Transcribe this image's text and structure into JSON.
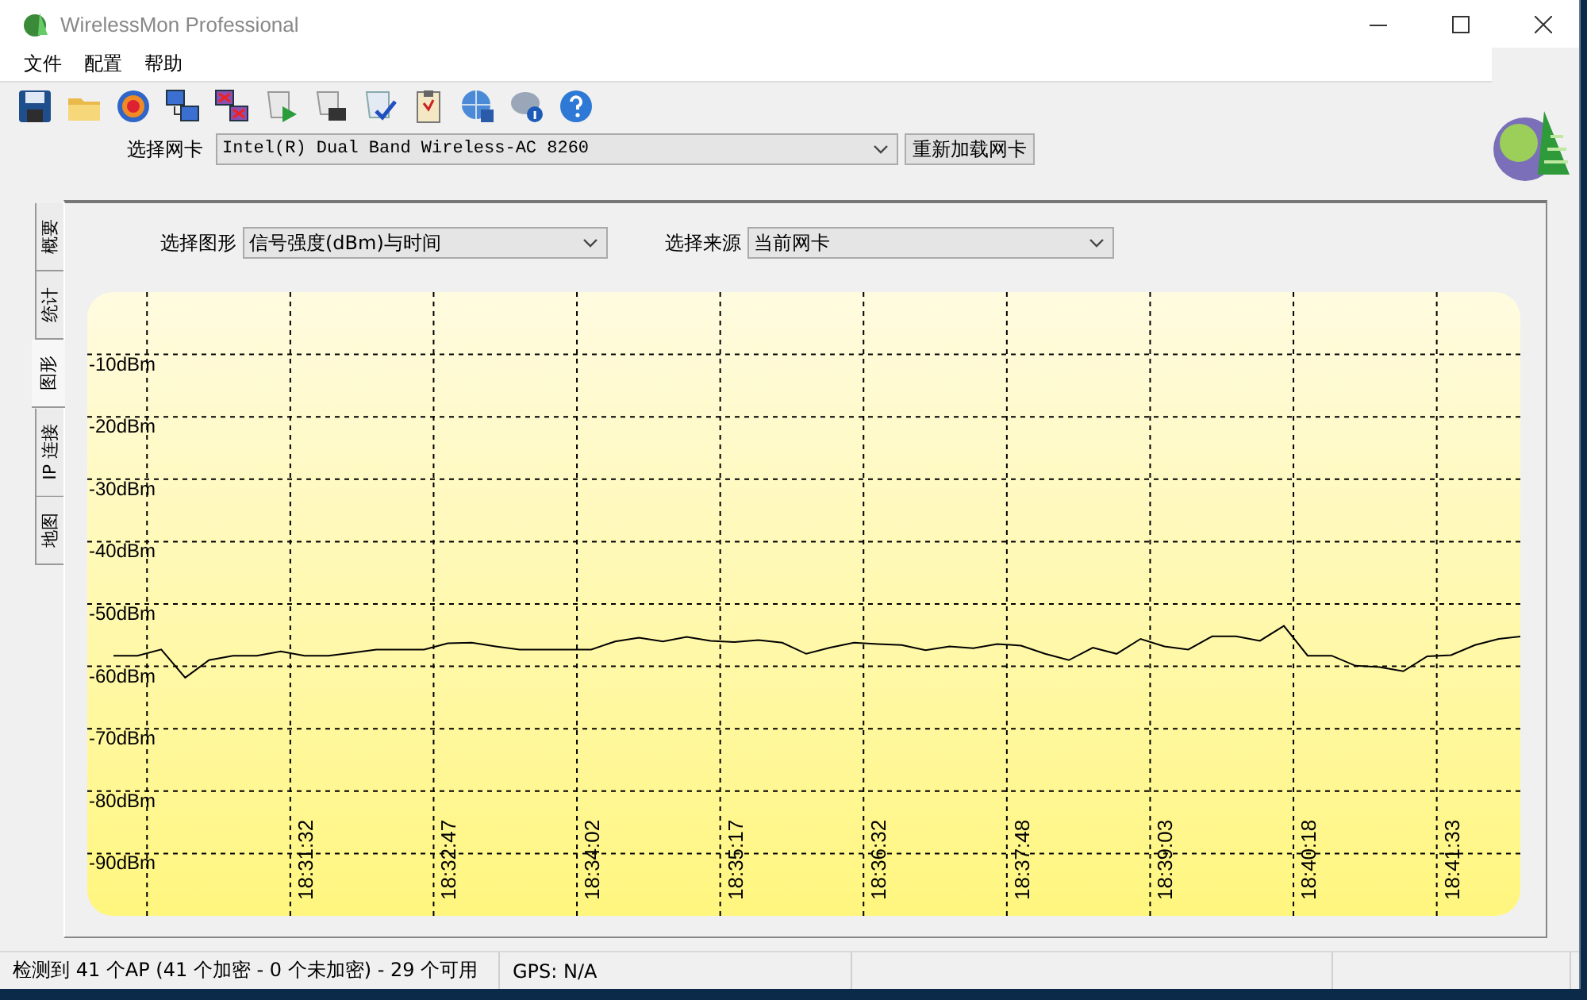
{
  "window": {
    "title": "WirelessMon Professional"
  },
  "menu": [
    "文件",
    "配置",
    "帮助"
  ],
  "adapter": {
    "label": "选择网卡",
    "value": "Intel(R) Dual Band Wireless-AC 8260",
    "reload_button": "重新加载网卡"
  },
  "tabs": [
    {
      "label": "概要",
      "selected": false
    },
    {
      "label": "统计",
      "selected": false
    },
    {
      "label": "图形",
      "selected": true
    },
    {
      "label": "IP 连接",
      "selected": false
    },
    {
      "label": "地图",
      "selected": false
    }
  ],
  "graph_select": {
    "label": "选择图形",
    "value": "信号强度(dBm)与时间"
  },
  "source_select": {
    "label": "选择来源",
    "value": "当前网卡"
  },
  "chart_data": {
    "type": "line",
    "ylim": [
      -100,
      0
    ],
    "categories": [
      null,
      null,
      null,
      null,
      null,
      null,
      null,
      null,
      "18:31:32",
      null,
      null,
      null,
      null,
      null,
      "18:32:47",
      null,
      null,
      null,
      null,
      null,
      "18:34:02",
      null,
      null,
      null,
      null,
      null,
      "18:35:17",
      null,
      null,
      null,
      null,
      null,
      "18:36:32",
      null,
      null,
      null,
      null,
      null,
      "18:37:48",
      null,
      null,
      null,
      null,
      null,
      "18:39:03",
      null,
      null,
      null,
      null,
      null,
      "18:40:18",
      null,
      null,
      null,
      null,
      null,
      "18:41:33",
      null,
      null,
      null
    ],
    "grid": true,
    "series": [
      {
        "color": "#000000",
        "values": [
          -58.3,
          -58.3,
          -57.3,
          -61.8,
          -59,
          -58.3,
          -58.3,
          -57.6,
          -58.3,
          -58.3,
          -57.8,
          -57.3,
          -57.3,
          -57.3,
          -56.3,
          -56.2,
          -56.8,
          -57.3,
          -57.3,
          -57.3,
          -57.3,
          -56,
          -55.4,
          -56,
          -55.3,
          -55.9,
          -56.1,
          -55.8,
          -56.2,
          -58,
          -57,
          -56.2,
          -56.4,
          -56.6,
          -57.4,
          -56.8,
          -57.1,
          -56.4,
          -56.7,
          -58,
          -59,
          -57,
          -58,
          -55.6,
          -56.8,
          -57.3,
          -55.2,
          -55.2,
          -55.9,
          -53.5,
          -58.3,
          -58.3,
          -59.9,
          -60.1,
          -60.8,
          -58.4,
          -58.2,
          -56.6,
          -55.6,
          -55.2
        ]
      }
    ],
    "yticks": [
      {
        "value": -10,
        "label": "-10dBm"
      },
      {
        "value": -20,
        "label": "-20dBm"
      },
      {
        "value": -30,
        "label": "-30dBm"
      },
      {
        "value": -40,
        "label": "-40dBm"
      },
      {
        "value": -50,
        "label": "-50dBm"
      },
      {
        "value": -60,
        "label": "-60dBm"
      },
      {
        "value": -70,
        "label": "-70dBm"
      },
      {
        "value": -80,
        "label": "-80dBm"
      },
      {
        "value": -90,
        "label": "-90dBm"
      }
    ]
  },
  "status_bar": [
    "检测到 41 个AP (41 个加密 - 0 个未加密) - 29 个可用",
    "GPS: N/A"
  ]
}
